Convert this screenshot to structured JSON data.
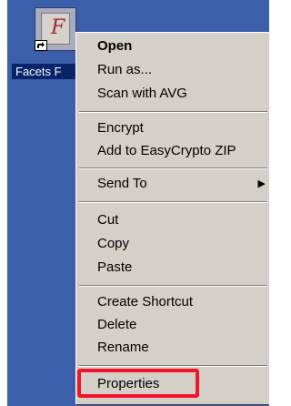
{
  "desktop": {
    "background_color": "#3b5faa",
    "shortcut": {
      "label": "Facets F",
      "icon_name": "facets-app-icon",
      "icon_glyph": "F",
      "overlay_icon_name": "shortcut-arrow-icon"
    }
  },
  "context_menu": {
    "items": [
      {
        "label": "Open",
        "bold": true
      },
      {
        "label": "Run as..."
      },
      {
        "label": "Scan with AVG"
      },
      {
        "label": "Encrypt"
      },
      {
        "label": "Add to EasyCrypto ZIP"
      },
      {
        "label": "Send To",
        "submenu_icon": "chevron-right-icon",
        "submenu_glyph": "▶"
      },
      {
        "label": "Cut"
      },
      {
        "label": "Copy"
      },
      {
        "label": "Paste"
      },
      {
        "label": "Create Shortcut"
      },
      {
        "label": "Delete"
      },
      {
        "label": "Rename"
      },
      {
        "label": "Properties"
      }
    ]
  },
  "highlight": {
    "target": "Properties",
    "color": "#f0162a"
  }
}
